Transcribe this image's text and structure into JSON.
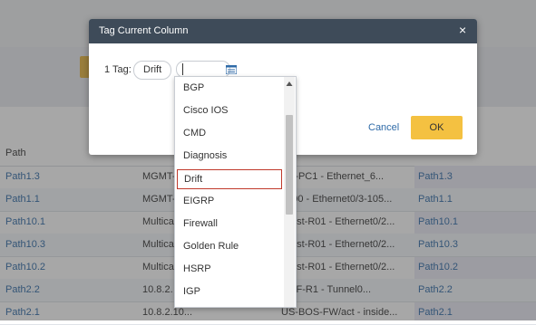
{
  "grid": {
    "header": {
      "path": "Path"
    },
    "rows": [
      {
        "path": "Path1.3",
        "device": "MGMT-",
        "interface": "MT-PC1 - Ethernet_6...",
        "path2": "Path1.3"
      },
      {
        "path": "Path1.1",
        "device": "MGMT-",
        "interface": "0000 - Ethernet0/3-105...",
        "path2": "Path1.1"
      },
      {
        "path": "Path10.1",
        "device": "Multica",
        "interface": "ticast-R01 - Ethernet0/2...",
        "path2": "Path10.1"
      },
      {
        "path": "Path10.3",
        "device": "Multica",
        "interface": "ticast-R01 - Ethernet0/2...",
        "path2": "Path10.3"
      },
      {
        "path": "Path10.2",
        "device": "Multica",
        "interface": "ticast-R01 - Ethernet0/2...",
        "path2": "Path10.2"
      },
      {
        "path": "Path2.2",
        "device": "10.8.2.",
        "interface": "SMF-R1 - Tunnel0...",
        "path2": "Path2.2"
      },
      {
        "path": "Path2.1",
        "device": "10.8.2.10...",
        "interface": "US-BOS-FW/act - inside...",
        "path2": "Path2.1"
      }
    ]
  },
  "dialog": {
    "title": "Tag Current Column",
    "close": "×",
    "tag_label": "1 Tag:",
    "chip": "Drift",
    "input_value": "",
    "cancel": "Cancel",
    "ok": "OK"
  },
  "dropdown": {
    "options": [
      "BGP",
      "Cisco IOS",
      "CMD",
      "Diagnosis",
      "Drift",
      "EIGRP",
      "Firewall",
      "Golden Rule",
      "HSRP",
      "IGP"
    ],
    "selected": "Drift"
  },
  "colors": {
    "header": "#3e4b59",
    "ok": "#f4c141",
    "link": "#2f6ba8",
    "selected_border": "#c0392b"
  }
}
